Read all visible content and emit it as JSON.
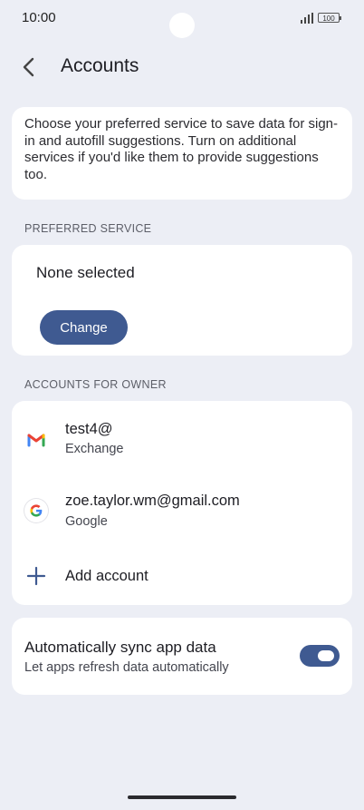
{
  "status_bar": {
    "time": "10:00",
    "battery": "100"
  },
  "app_bar": {
    "title": "Accounts"
  },
  "intro": {
    "text": "Choose your preferred service to save data for sign-in and autofill suggestions. Turn on additional services if you'd like them to provide suggestions too."
  },
  "preferred_service": {
    "section_label": "PREFERRED SERVICE",
    "value": "None selected",
    "change_label": "Change"
  },
  "accounts_section": {
    "section_label": "ACCOUNTS FOR OWNER",
    "items": [
      {
        "name": "test4@",
        "type": "Exchange",
        "icon": "gmail-icon"
      },
      {
        "name": "zoe.taylor.wm@gmail.com",
        "type": "Google",
        "icon": "google-icon"
      }
    ],
    "add_label": "Add account"
  },
  "sync": {
    "title": "Automatically sync app data",
    "subtitle": "Let apps refresh data automatically",
    "enabled": true
  },
  "colors": {
    "accent": "#3f5a91",
    "background": "#eceef5",
    "card": "#ffffff"
  }
}
